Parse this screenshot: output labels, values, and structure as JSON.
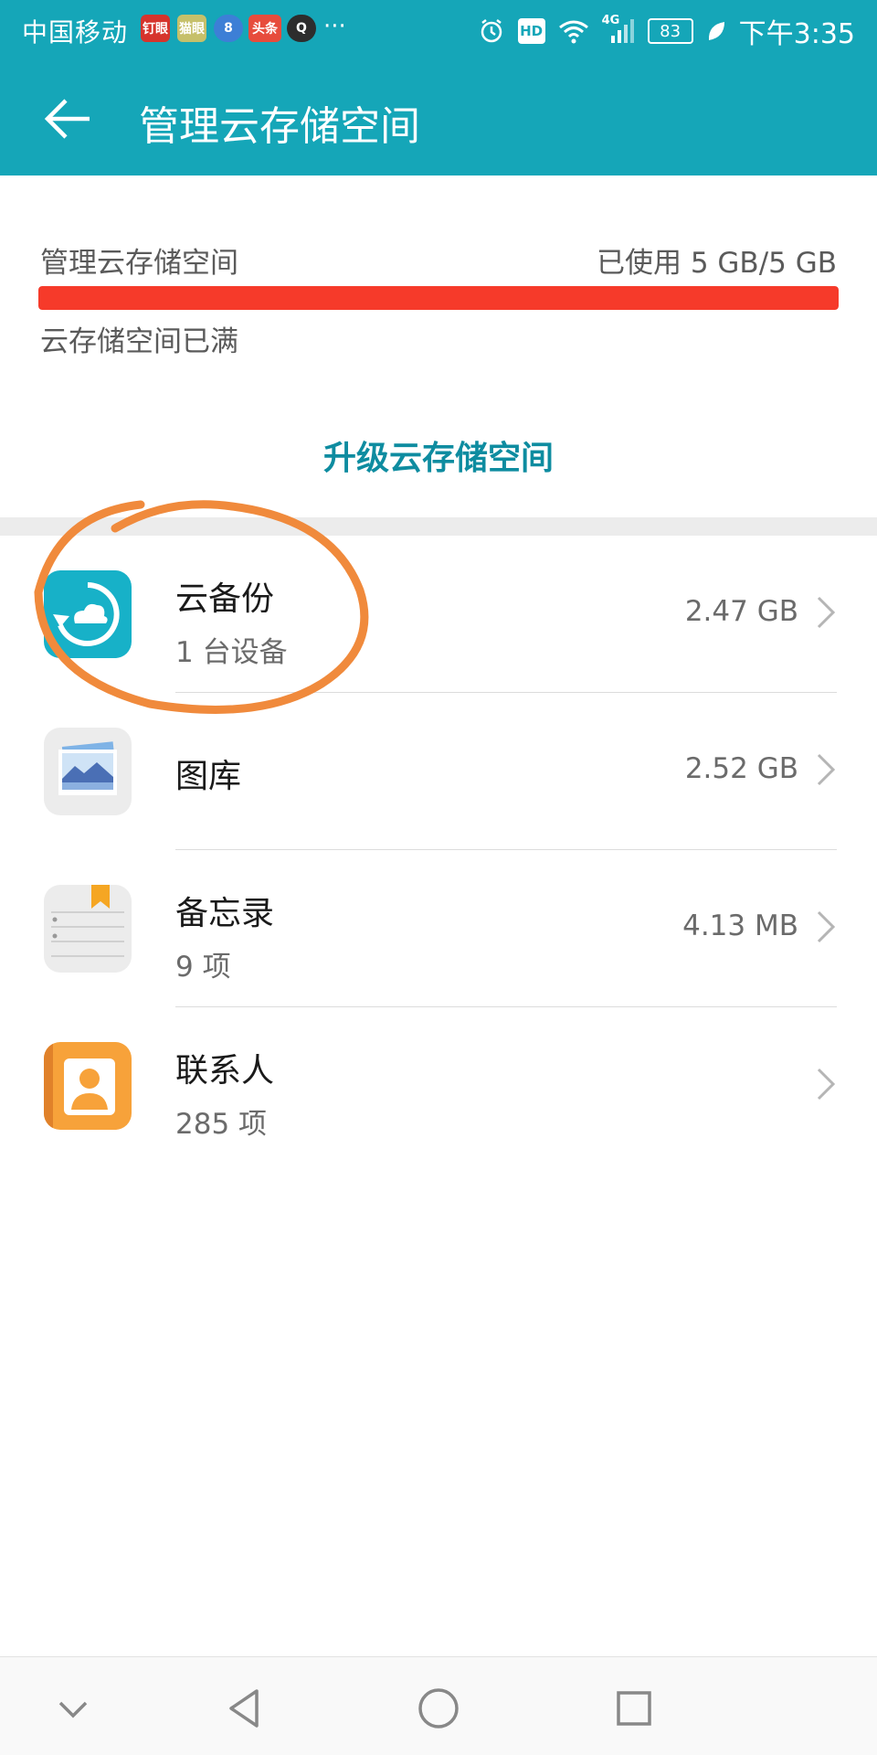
{
  "status_bar": {
    "carrier": "中国移动",
    "notif_badges": [
      "钉眼",
      "猫眼",
      "8",
      "头条",
      "Q"
    ],
    "more": "···",
    "hd": "HD",
    "network": "4G",
    "battery": "83",
    "time": "下午3:35"
  },
  "toolbar": {
    "title": "管理云存储空间"
  },
  "storage": {
    "label": "管理云存储空间",
    "used_text": "已使用 5 GB/5 GB",
    "used_fraction": 1.0,
    "status": "云存储空间已满",
    "upgrade_label": "升级云存储空间"
  },
  "items": [
    {
      "name": "云备份",
      "sub": "1 台设备",
      "size": "2.47 GB",
      "icon": "cloud-backup-icon"
    },
    {
      "name": "图库",
      "sub": "",
      "size": "2.52 GB",
      "icon": "gallery-icon"
    },
    {
      "name": "备忘录",
      "sub": "9 项",
      "size": "4.13 MB",
      "icon": "notes-icon"
    },
    {
      "name": "联系人",
      "sub": "285 项",
      "size": "",
      "icon": "contacts-icon"
    }
  ],
  "colors": {
    "toolbar": "#15a6b8",
    "accent": "#0e8ca0",
    "progress": "#f63a2a",
    "annotation": "#f08a3c"
  }
}
